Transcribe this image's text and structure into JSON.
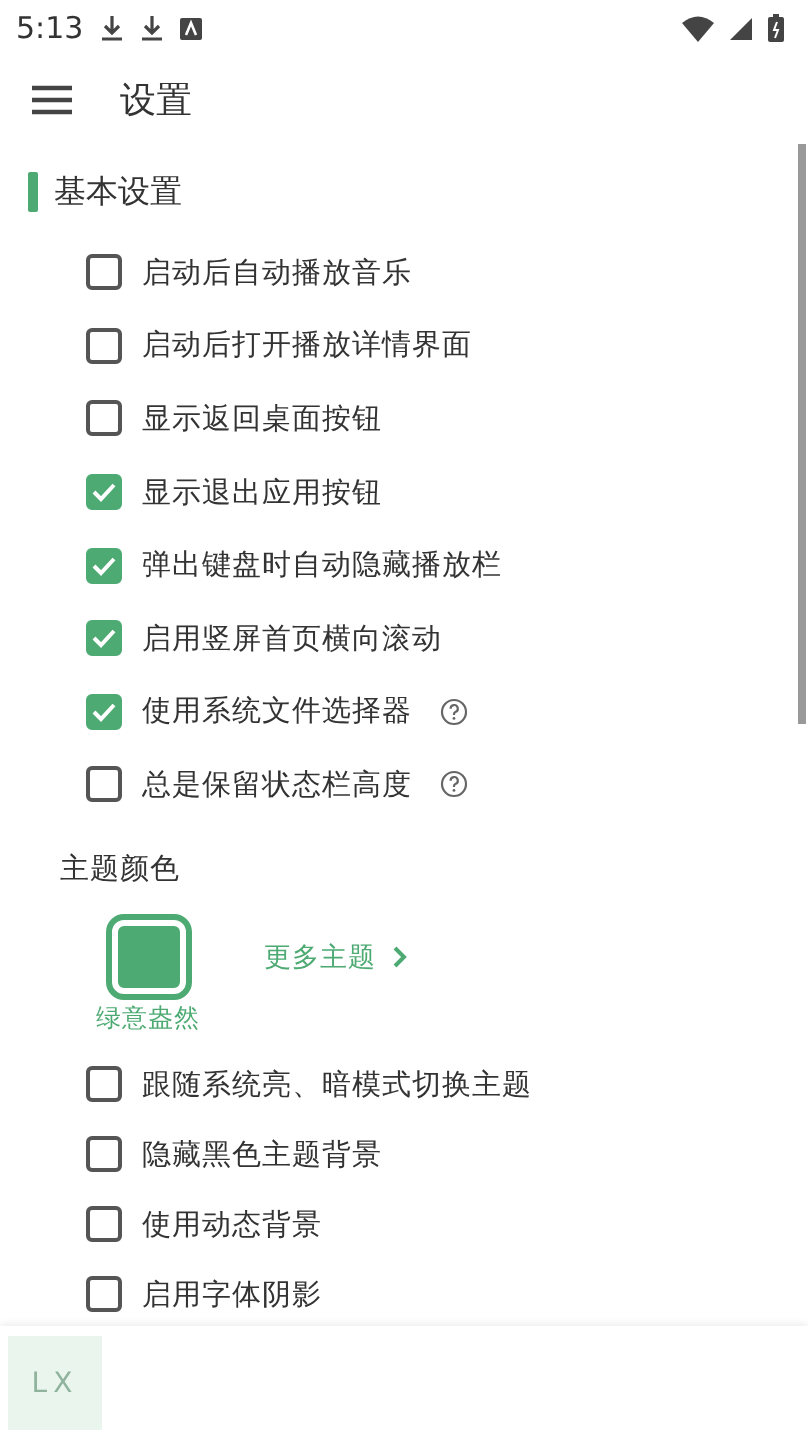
{
  "status_bar": {
    "time": "5:13"
  },
  "header": {
    "title": "设置"
  },
  "section": {
    "title": "基本设置"
  },
  "options": [
    {
      "label": "启动后自动播放音乐",
      "checked": false,
      "help": false
    },
    {
      "label": "启动后打开播放详情界面",
      "checked": false,
      "help": false
    },
    {
      "label": "显示返回桌面按钮",
      "checked": false,
      "help": false
    },
    {
      "label": "显示退出应用按钮",
      "checked": true,
      "help": false
    },
    {
      "label": "弹出键盘时自动隐藏播放栏",
      "checked": true,
      "help": false
    },
    {
      "label": "启用竖屏首页横向滚动",
      "checked": true,
      "help": false
    },
    {
      "label": "使用系统文件选择器",
      "checked": true,
      "help": true
    },
    {
      "label": "总是保留状态栏高度",
      "checked": false,
      "help": true
    }
  ],
  "theme": {
    "title": "主题颜色",
    "themes": [
      {
        "name": "绿意盎然",
        "color": "#4daa72",
        "selected": true
      }
    ],
    "more_link": "更多主题"
  },
  "theme_options": [
    {
      "label": "跟随系统亮、暗模式切换主题",
      "checked": false
    },
    {
      "label": "隐藏黑色主题背景",
      "checked": false
    },
    {
      "label": "使用动态背景",
      "checked": false
    },
    {
      "label": "启用字体阴影",
      "checked": false
    }
  ],
  "player_bar": {
    "cover_text": "LX"
  }
}
